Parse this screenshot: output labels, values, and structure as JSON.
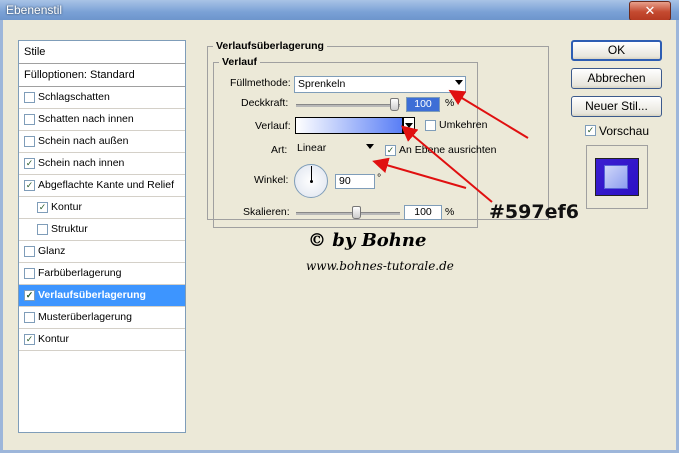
{
  "window": {
    "title": "Ebenenstil",
    "close_glyph": "✕"
  },
  "sidebar": {
    "header": "Stile",
    "options": "Fülloptionen: Standard",
    "items": [
      {
        "label": "Schlagschatten",
        "checked": false,
        "sub": false,
        "selected": false
      },
      {
        "label": "Schatten nach innen",
        "checked": false,
        "sub": false,
        "selected": false
      },
      {
        "label": "Schein nach außen",
        "checked": false,
        "sub": false,
        "selected": false
      },
      {
        "label": "Schein nach innen",
        "checked": true,
        "sub": false,
        "selected": false
      },
      {
        "label": "Abgeflachte Kante und Relief",
        "checked": true,
        "sub": false,
        "selected": false
      },
      {
        "label": "Kontur",
        "checked": true,
        "sub": true,
        "selected": false
      },
      {
        "label": "Struktur",
        "checked": false,
        "sub": true,
        "selected": false
      },
      {
        "label": "Glanz",
        "checked": false,
        "sub": false,
        "selected": false
      },
      {
        "label": "Farbüberlagerung",
        "checked": false,
        "sub": false,
        "selected": false
      },
      {
        "label": "Verlaufsüberlagerung",
        "checked": true,
        "sub": false,
        "selected": true
      },
      {
        "label": "Musterüberlagerung",
        "checked": false,
        "sub": false,
        "selected": false
      },
      {
        "label": "Kontur",
        "checked": true,
        "sub": false,
        "selected": false
      }
    ]
  },
  "panel": {
    "title": "Verlaufsüberlagerung",
    "group_title": "Verlauf",
    "blend_label": "Füllmethode:",
    "blend_value": "Sprenkeln",
    "opacity_label": "Deckkraft:",
    "opacity_value": "100",
    "opacity_unit": "%",
    "opacity_level": 1.0,
    "gradient_label": "Verlauf:",
    "gradient_from": "#ffffff",
    "gradient_to": "#597ef6",
    "reverse_label": "Umkehren",
    "reverse_checked": false,
    "style_label": "Art:",
    "style_value": "Linear",
    "align_label": "An Ebene ausrichten",
    "align_checked": true,
    "angle_label": "Winkel:",
    "angle_value": "90",
    "angle_unit": "°",
    "scale_label": "Skalieren:",
    "scale_value": "100",
    "scale_unit": "%",
    "scale_level": 1.0
  },
  "buttons": {
    "ok": "OK",
    "cancel": "Abbrechen",
    "new_style": "Neuer Stil...",
    "preview_label": "Vorschau",
    "preview_checked": true
  },
  "annotations": {
    "hex": "#597ef6",
    "credit": "© by Bohne",
    "url": "www.bohnes-tutorale.de",
    "arrow_color": "#e01010"
  },
  "icons": {
    "checkbox": "checkmark-icon",
    "dropdown": "chevron-down-icon",
    "dial": "angle-dial-icon"
  }
}
